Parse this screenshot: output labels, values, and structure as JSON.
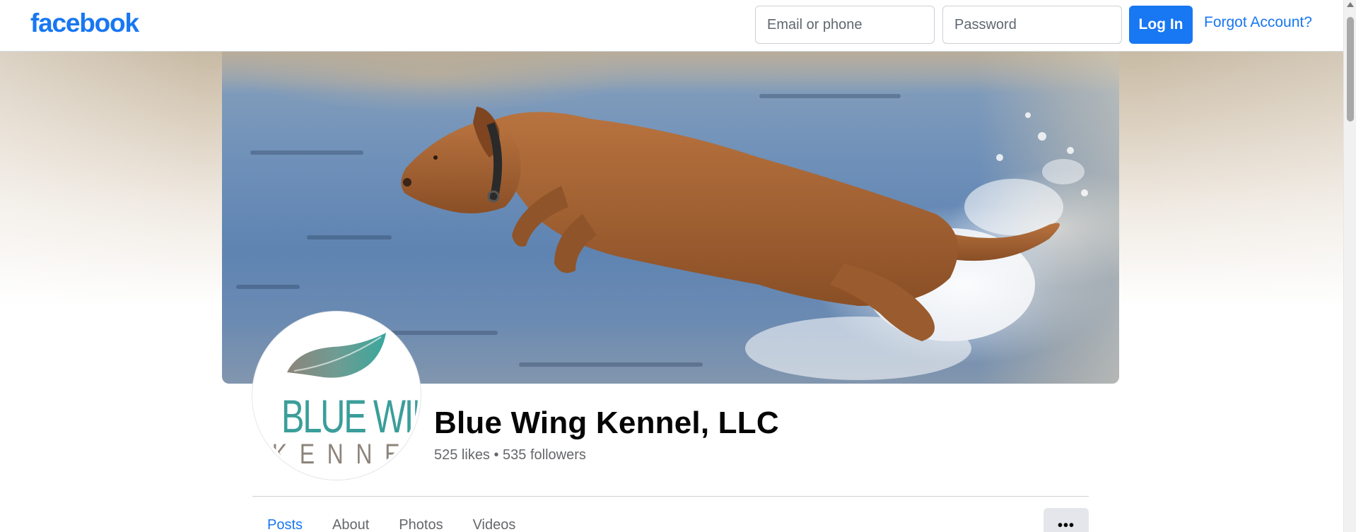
{
  "header": {
    "logo_text": "facebook",
    "email_placeholder": "Email or phone",
    "password_placeholder": "Password",
    "login_label": "Log In",
    "forgot_label": "Forgot Account?"
  },
  "cover": {
    "alt": "Cover photo: a brown dog leaping through a river"
  },
  "profile": {
    "avatar_line1": "BLUE WING",
    "avatar_line2": "KENNE",
    "page_name": "Blue Wing Kennel, LLC",
    "stats": "525 likes • 535 followers"
  },
  "tabs": [
    {
      "label": "Posts",
      "active": true
    },
    {
      "label": "About",
      "active": false
    },
    {
      "label": "Photos",
      "active": false
    },
    {
      "label": "Videos",
      "active": false
    }
  ],
  "more_label": "•••",
  "colors": {
    "brand": "#1877f2",
    "logo_teal": "#3a9e9a",
    "logo_taupe": "#8d847b"
  },
  "icons": {
    "scroll_up": "triangle-up-icon",
    "more": "more-horizontal-icon",
    "feather": "feather-logo-icon"
  }
}
